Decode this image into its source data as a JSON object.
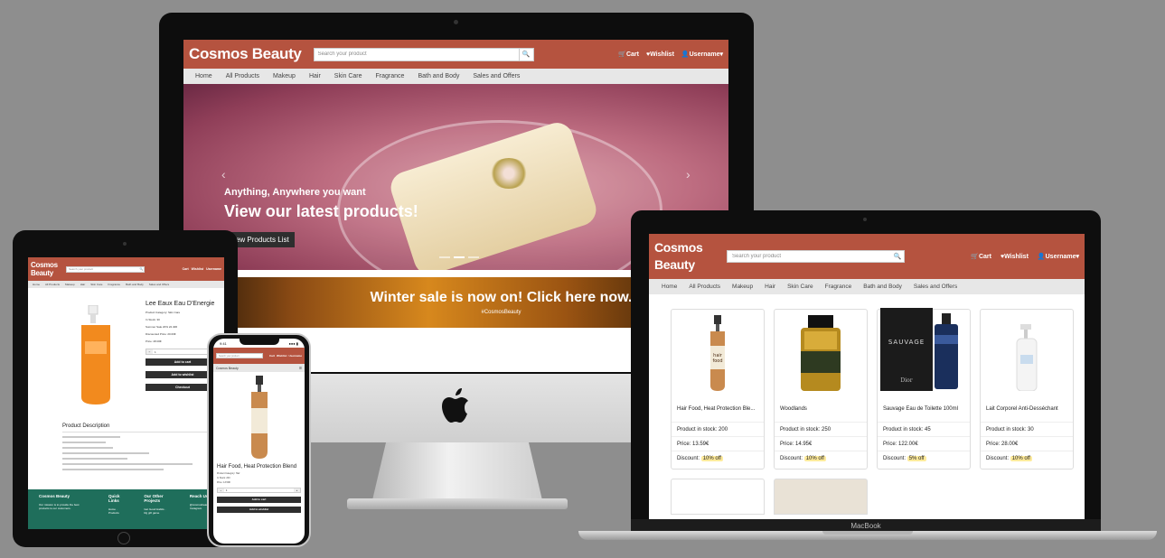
{
  "site": {
    "brand": "Cosmos Beauty",
    "search_placeholder": "Search your product",
    "cart_label": "Cart",
    "wishlist_label": "Wishlist",
    "username_label": "Username",
    "categories": [
      "Home",
      "All Products",
      "Makeup",
      "Hair",
      "Skin Care",
      "Fragrance",
      "Bath and Body",
      "Sales and Offers"
    ]
  },
  "imac": {
    "hero_tagline": "Anything, Anywhere you want",
    "hero_headline": "View our latest products!",
    "hero_button": "View Products List",
    "sale_text": "Winter sale is now on! Click here now.",
    "sale_hashtag": "#CosmosBeauty"
  },
  "macbook": {
    "label": "MacBook",
    "products": [
      {
        "name": "Hair Food, Heat Protection Ble...",
        "stock": "Product in stock: 200",
        "price": "Price: 13.59€",
        "discount_label": "Discount:",
        "discount": "10% off"
      },
      {
        "name": "Woodlands",
        "stock": "Product in stock: 250",
        "price": "Price: 14.95€",
        "discount_label": "Discount:",
        "discount": "10% off"
      },
      {
        "name": "Sauvage Eau de Toilette 100ml",
        "stock": "Product in stock: 45",
        "price": "Price: 122.00€",
        "discount_label": "Discount:",
        "discount": "5% off"
      },
      {
        "name": "Lait Corporel Anti-Desséchant",
        "stock": "Product in stock: 30",
        "price": "Price: 28.00€",
        "discount_label": "Discount:",
        "discount": "10% off"
      }
    ]
  },
  "ipad": {
    "product_title": "Lee Eaux Eau D'Energie",
    "category_line": "Product Category: Skin Care",
    "in_stock_line": "In Stock: 30",
    "original_price_line": "Summer Sale 20% 22.40€",
    "discounted_line": "Discounted Price: 20.00€",
    "price_line": "Price: 28.00€",
    "qty_value": "1",
    "add_to_cart": "Add to cart",
    "add_to_wishlist": "Add to wishlist",
    "checkout": "Checkout",
    "description_heading": "Product Description",
    "footer": [
      {
        "title": "Cosmos Beauty",
        "text": "Our mission is to provide the best products to our customers."
      },
      {
        "title": "Quick Links",
        "text": "Home · Products"
      },
      {
        "title": "Our Other Projects",
        "text": "Get Good Habits · Rg gift game"
      },
      {
        "title": "Reach Us",
        "text": "@cosmosbeauty · Instagram"
      }
    ]
  },
  "iphone": {
    "time": "9:41",
    "brand": "Cosmos Beauty",
    "product_title": "Hair Food, Heat Protection Blend",
    "category_line": "Product Category: Hair",
    "stock_line": "In Stock: 200",
    "price_line": "Price: 13.59€",
    "qty_value": "1",
    "add_to_cart": "Add to cart",
    "add_to_wishlist": "Add to wishlist"
  }
}
